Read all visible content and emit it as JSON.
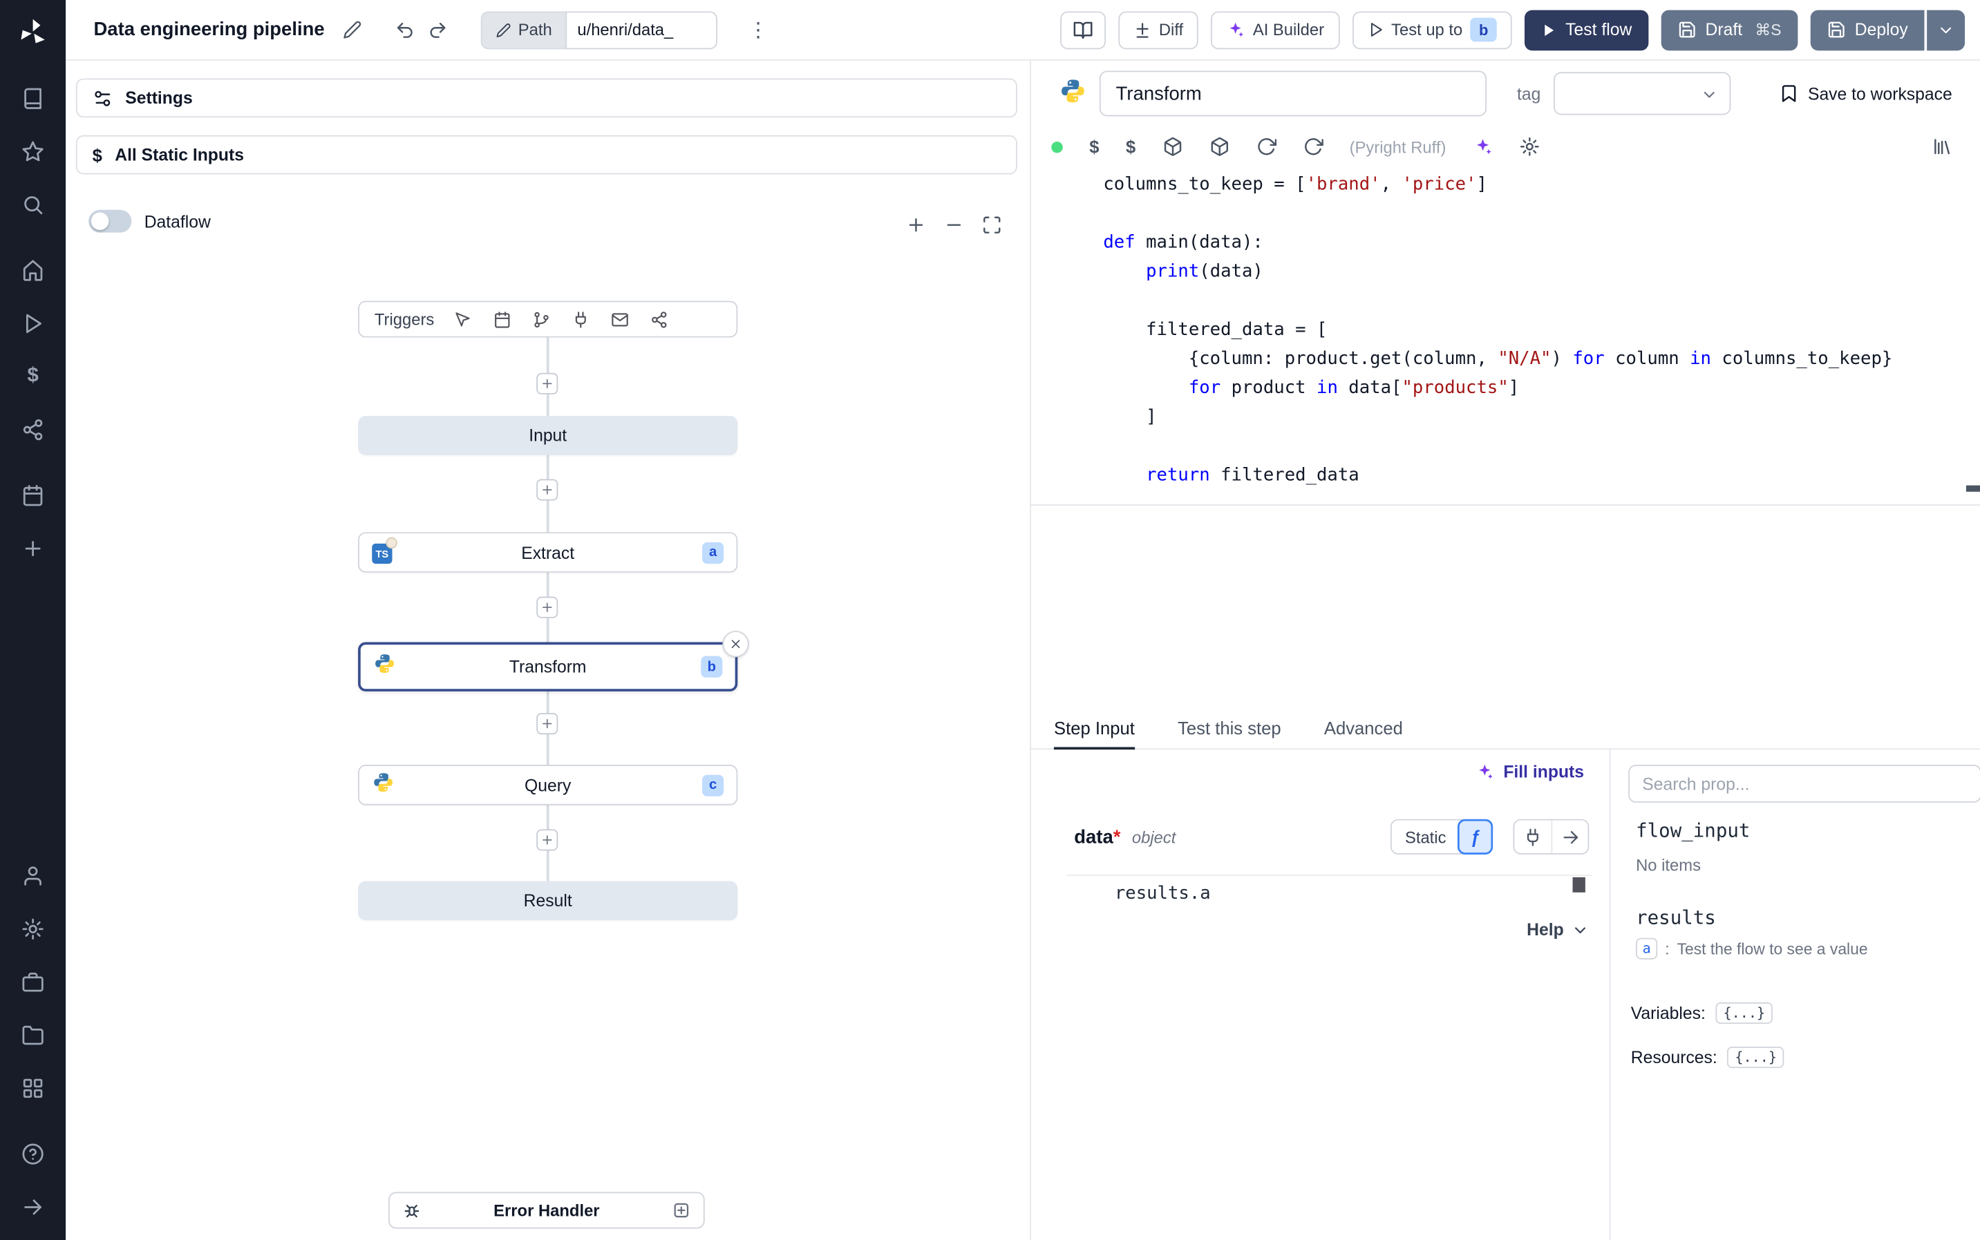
{
  "topbar": {
    "title": "Data engineering pipeline",
    "path_label": "Path",
    "path_value": "u/henri/data_",
    "diff_label": "Diff",
    "ai_builder_label": "AI Builder",
    "test_up_to_label": "Test up to",
    "test_up_to_badge": "b",
    "test_flow_label": "Test flow",
    "draft_label": "Draft",
    "draft_shortcut": "⌘S",
    "deploy_label": "Deploy"
  },
  "icons": {
    "kebab": "⋮",
    "dollar": "$",
    "expression_toggle": "ƒ"
  },
  "flow_panel": {
    "settings_label": "Settings",
    "static_inputs_label": "All Static Inputs",
    "dataflow_label": "Dataflow",
    "triggers_label": "Triggers",
    "nodes": {
      "input": {
        "label": "Input"
      },
      "extract": {
        "label": "Extract",
        "badge": "a",
        "lang": "TS"
      },
      "transform": {
        "label": "Transform",
        "badge": "b"
      },
      "query": {
        "label": "Query",
        "badge": "c"
      },
      "result": {
        "label": "Result"
      }
    },
    "error_handler_label": "Error Handler"
  },
  "step_editor": {
    "name_value": "Transform",
    "tag_label": "tag",
    "save_label": "Save to workspace",
    "lint_label": "(Pyright Ruff)",
    "code_lines": [
      [
        {
          "t": "columns_to_keep = [",
          "c": "p"
        },
        {
          "t": "'brand'",
          "c": "s"
        },
        {
          "t": ", ",
          "c": "p"
        },
        {
          "t": "'price'",
          "c": "s"
        },
        {
          "t": "]",
          "c": "p"
        }
      ],
      [],
      [
        {
          "t": "def ",
          "c": "k"
        },
        {
          "t": "main(data):",
          "c": "p"
        }
      ],
      [
        {
          "t": "    ",
          "c": "p"
        },
        {
          "t": "print",
          "c": "k"
        },
        {
          "t": "(data)",
          "c": "p"
        }
      ],
      [],
      [
        {
          "t": "    filtered_data = [",
          "c": "p"
        }
      ],
      [
        {
          "t": "        {column: product.get(column, ",
          "c": "p"
        },
        {
          "t": "\"N/A\"",
          "c": "s"
        },
        {
          "t": ") ",
          "c": "p"
        },
        {
          "t": "for",
          "c": "k"
        },
        {
          "t": " column ",
          "c": "p"
        },
        {
          "t": "in",
          "c": "k"
        },
        {
          "t": " columns_to_keep}",
          "c": "p"
        }
      ],
      [
        {
          "t": "        ",
          "c": "p"
        },
        {
          "t": "for",
          "c": "k"
        },
        {
          "t": " product ",
          "c": "p"
        },
        {
          "t": "in",
          "c": "k"
        },
        {
          "t": " data[",
          "c": "p"
        },
        {
          "t": "\"products\"",
          "c": "s"
        },
        {
          "t": "]",
          "c": "p"
        }
      ],
      [
        {
          "t": "    ]",
          "c": "p"
        }
      ],
      [],
      [
        {
          "t": "    ",
          "c": "p"
        },
        {
          "t": "return",
          "c": "k"
        },
        {
          "t": " filtered_data",
          "c": "p"
        }
      ]
    ]
  },
  "tabs": {
    "step_input": "Step Input",
    "test_step": "Test this step",
    "advanced": "Advanced"
  },
  "step_input": {
    "fill_inputs_label": "Fill inputs",
    "arg_name": "data",
    "required_marker": "*",
    "arg_type": "object",
    "static_label": "Static",
    "expr_value": "results.a",
    "help_label": "Help"
  },
  "prop_picker": {
    "search_placeholder": "Search prop...",
    "flow_input_label": "flow_input",
    "flow_input_empty": "No items",
    "results_label": "results",
    "result_key": "a",
    "result_sep": ":",
    "result_hint": "Test the flow to see a value",
    "variables_label": "Variables:",
    "variables_value": "{...}",
    "resources_label": "Resources:",
    "resources_value": "{...}"
  }
}
